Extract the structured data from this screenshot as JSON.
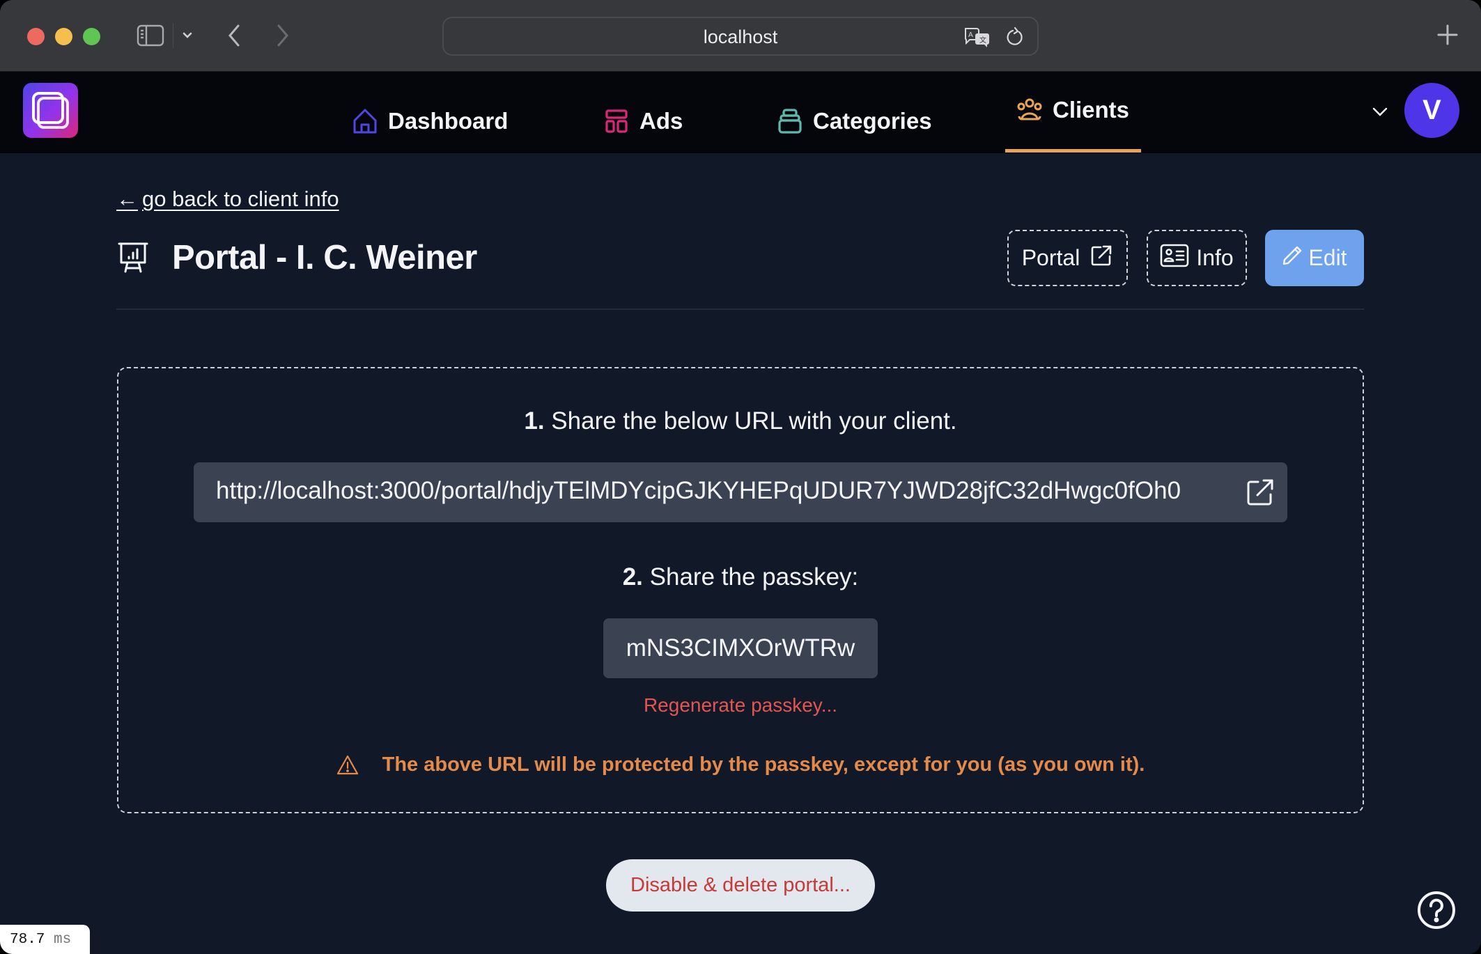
{
  "browser": {
    "address": "localhost",
    "icons": [
      "sidebar-toggle-icon",
      "chevron-down-icon",
      "back-arrow-icon",
      "forward-arrow-icon",
      "translate-icon",
      "reload-icon",
      "new-tab-plus-icon"
    ]
  },
  "nav": {
    "logo": "app-logo",
    "items": [
      {
        "label": "Dashboard",
        "icon": "home-icon",
        "color": "#4f46e5",
        "active": false
      },
      {
        "label": "Ads",
        "icon": "layout-icon",
        "color": "#db2777",
        "active": false
      },
      {
        "label": "Categories",
        "icon": "archive-box-icon",
        "color": "#5eb9ad",
        "active": false
      },
      {
        "label": "Clients",
        "icon": "users-group-icon",
        "color": "#e8a55a",
        "active": true
      }
    ],
    "avatar_initial": "V",
    "avatar_color": "#4f35e8"
  },
  "page": {
    "back_link": "go back to client info",
    "back_arrow": "←",
    "title": "Portal - I. C. Weiner",
    "title_icon": "presentation-chart-icon",
    "actions": {
      "portal_label": "Portal",
      "info_label": "Info",
      "edit_label": "Edit"
    }
  },
  "share": {
    "step1_number": "1.",
    "step1_text": "Share the below URL with your client.",
    "url": "http://localhost:3000/portal/hdjyTElMDYcipGJKYHEPqUDUR7YJWD28jfC32dHwgc0fOh0",
    "step2_number": "2.",
    "step2_text": "Share the passkey:",
    "passkey": "mNS3CIMXOrWTRw",
    "regenerate_label": "Regenerate passkey...",
    "warning": "The above URL will be protected by the passkey, except for you (as you own it)."
  },
  "footer": {
    "delete_label": "Disable & delete portal...",
    "help_icon": "question-circle-icon"
  },
  "timing": {
    "value": "78.7",
    "unit": "ms"
  },
  "colors": {
    "background": "#111827",
    "nav_background": "#05060c",
    "edit_button": "#6ea2ec",
    "warning": "#e48a4a",
    "danger": "#e45552",
    "active_tab_underline": "#e8a55a"
  }
}
